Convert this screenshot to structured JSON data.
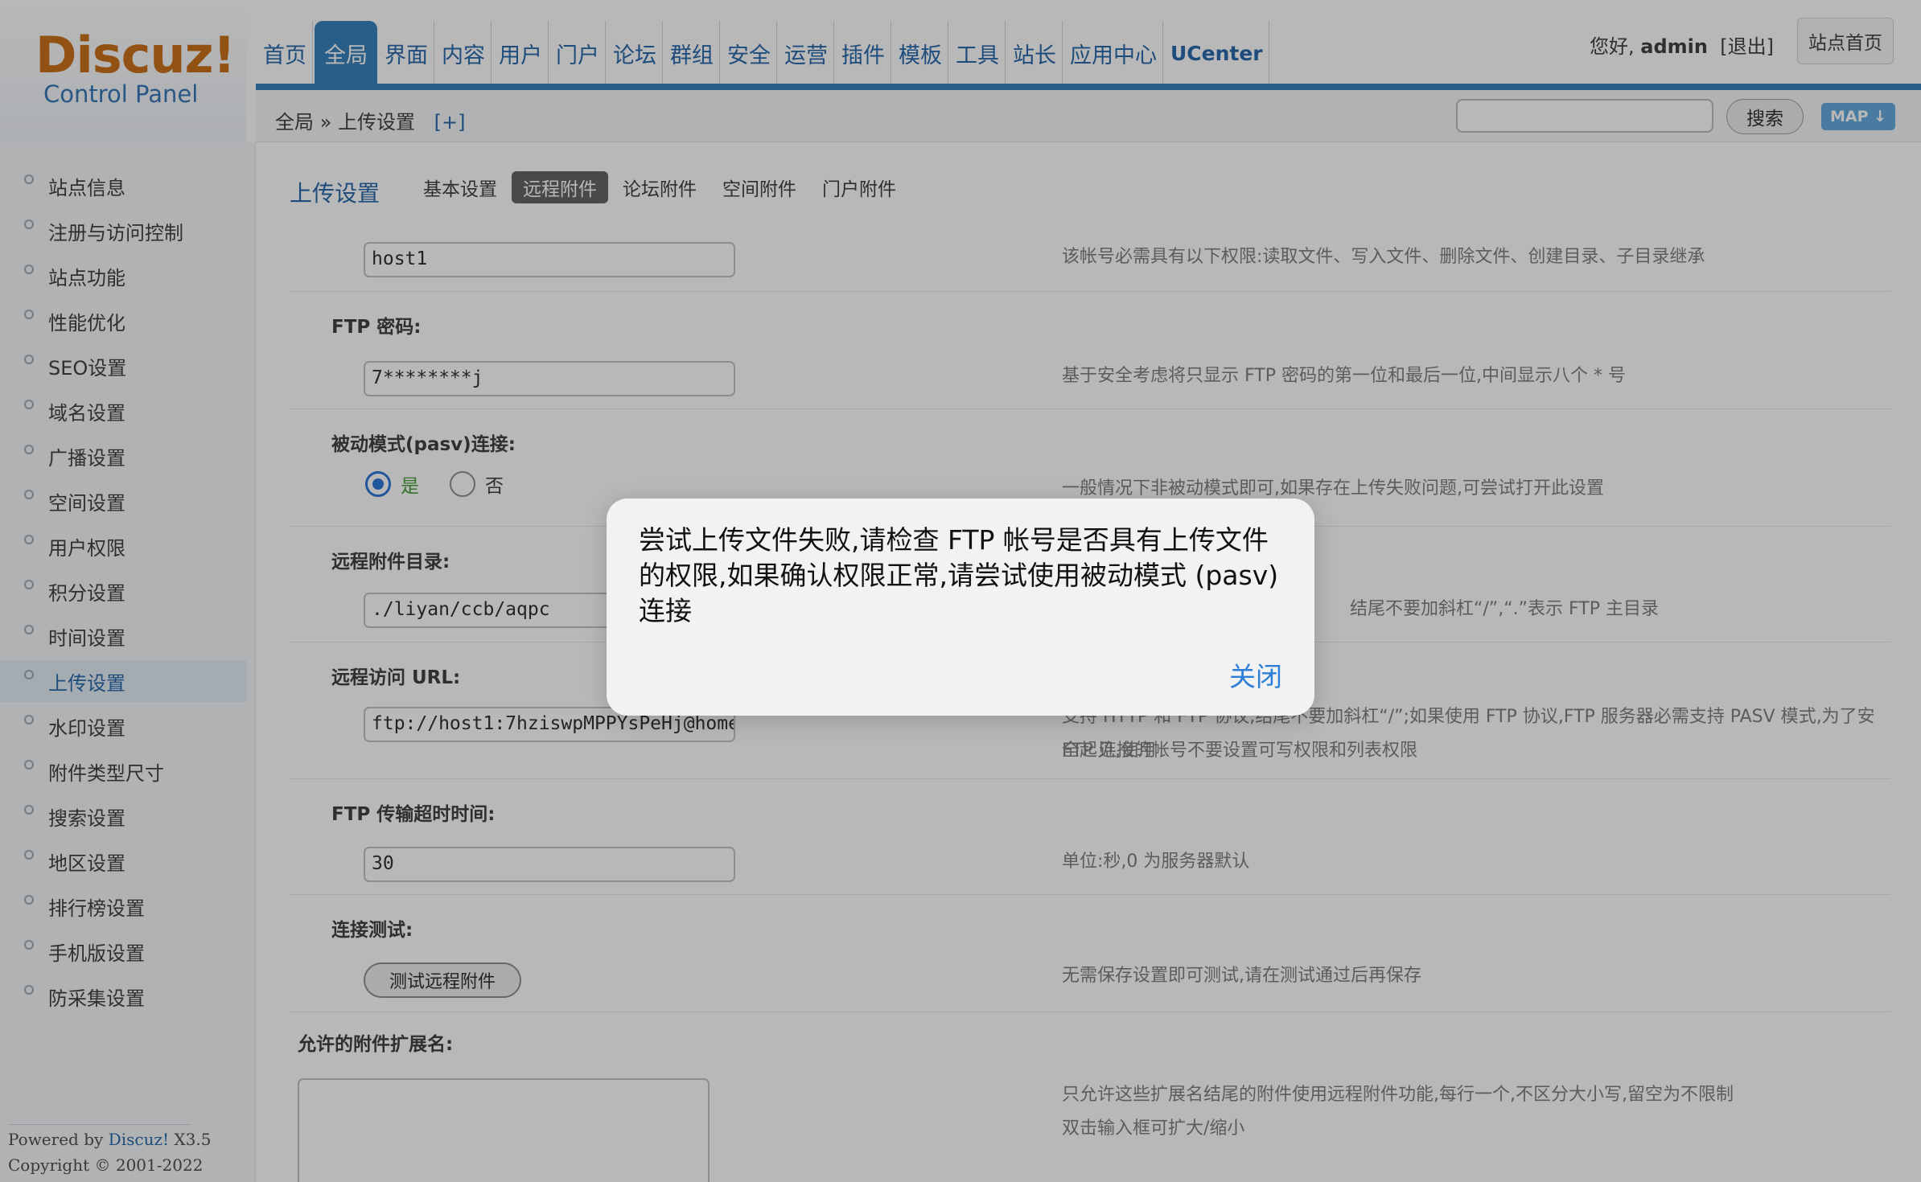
{
  "header": {
    "logo_main": "Discuz!",
    "logo_sub": "Control Panel",
    "nav": [
      {
        "label": "首页"
      },
      {
        "label": "全局"
      },
      {
        "label": "界面"
      },
      {
        "label": "内容"
      },
      {
        "label": "用户"
      },
      {
        "label": "门户"
      },
      {
        "label": "论坛"
      },
      {
        "label": "群组"
      },
      {
        "label": "安全"
      },
      {
        "label": "运营"
      },
      {
        "label": "插件"
      },
      {
        "label": "模板"
      },
      {
        "label": "工具"
      },
      {
        "label": "站长"
      },
      {
        "label": "应用中心"
      },
      {
        "label": "UCenter"
      }
    ],
    "active_nav": "全局",
    "greeting_prefix": "您好,",
    "username": "admin",
    "logout": "[退出]",
    "site_home": "站点首页",
    "breadcrumb": "全局 » 上传设置",
    "breadcrumb_plus": "[+]",
    "search_placeholder": "",
    "search_button": "搜索",
    "map_button": "MAP ↓"
  },
  "sidebar": {
    "items": [
      {
        "label": "站点信息"
      },
      {
        "label": "注册与访问控制"
      },
      {
        "label": "站点功能"
      },
      {
        "label": "性能优化"
      },
      {
        "label": "SEO设置"
      },
      {
        "label": "域名设置"
      },
      {
        "label": "广播设置"
      },
      {
        "label": "空间设置"
      },
      {
        "label": "用户权限"
      },
      {
        "label": "积分设置"
      },
      {
        "label": "时间设置"
      },
      {
        "label": "上传设置"
      },
      {
        "label": "水印设置"
      },
      {
        "label": "附件类型尺寸"
      },
      {
        "label": "搜索设置"
      },
      {
        "label": "地区设置"
      },
      {
        "label": "排行榜设置"
      },
      {
        "label": "手机版设置"
      },
      {
        "label": "防采集设置"
      }
    ],
    "active": "上传设置",
    "powered_prefix": "Powered by",
    "powered_brand": "Discuz!",
    "powered_version": "X3.5",
    "copyright": "Copyright © 2001-2022"
  },
  "main": {
    "title": "上传设置",
    "tabs": [
      {
        "label": "基本设置"
      },
      {
        "label": "远程附件"
      },
      {
        "label": "论坛附件"
      },
      {
        "label": "空间附件"
      },
      {
        "label": "门户附件"
      }
    ],
    "active_tab": "远程附件",
    "ftp_account": {
      "value": "host1",
      "tip": "该帐号必需具有以下权限:读取文件、写入文件、删除文件、创建目录、子目录继承"
    },
    "ftp_password": {
      "label": "FTP 密码:",
      "value": "7********j",
      "tip": "基于安全考虑将只显示 FTP 密码的第一位和最后一位,中间显示八个 * 号"
    },
    "pasv": {
      "label": "被动模式(pasv)连接:",
      "yes": "是",
      "no": "否",
      "selected": "是",
      "tip": "一般情况下非被动模式即可,如果存在上传失败问题,可尝试打开此设置"
    },
    "remote_dir": {
      "label": "远程附件目录:",
      "value": "./liyan/ccb/aqpc",
      "tip": "结尾不要加斜杠“/”,“.”表示 FTP 主目录"
    },
    "remote_url": {
      "label": "远程访问 URL:",
      "value": "ftp://host1:7hziswpMPPYsPeHj@home",
      "tip_line1": "支持 HTTP 和 FTP 协议,结尾不要加斜杠“/”;如果使用 FTP 协议,FTP 服务器必需支持 PASV 模式,为了安全起见,使用",
      "tip_line2": "FTP 连接的帐号不要设置可写权限和列表权限"
    },
    "timeout": {
      "label": "FTP 传输超时时间:",
      "value": "30",
      "tip": "单位:秒,0 为服务器默认"
    },
    "conn_test": {
      "label": "连接测试:",
      "button": "测试远程附件",
      "tip": "无需保存设置即可测试,请在测试通过后再保存"
    },
    "allowed_ext": {
      "label": "允许的附件扩展名:",
      "value": "",
      "tip_line1": "只允许这些扩展名结尾的附件使用远程附件功能,每行一个,不区分大小写,留空为不限制",
      "tip_line2": "双击输入框可扩大/缩小"
    }
  },
  "dialog": {
    "message": "尝试上传文件失败,请检查 FTP 帐号是否具有上传文件的权限,如果确认权限正常,请尝试使用被动模式 (pasv) 连接",
    "close": "关闭"
  },
  "colors": {
    "nav_active": "#2a7ab8",
    "link": "#1a5ea6",
    "logo": "#c7670a",
    "radio_selected": "#1f6fd6",
    "yes_label": "#3c9b2e",
    "dialog_close": "#2f7ed8"
  }
}
